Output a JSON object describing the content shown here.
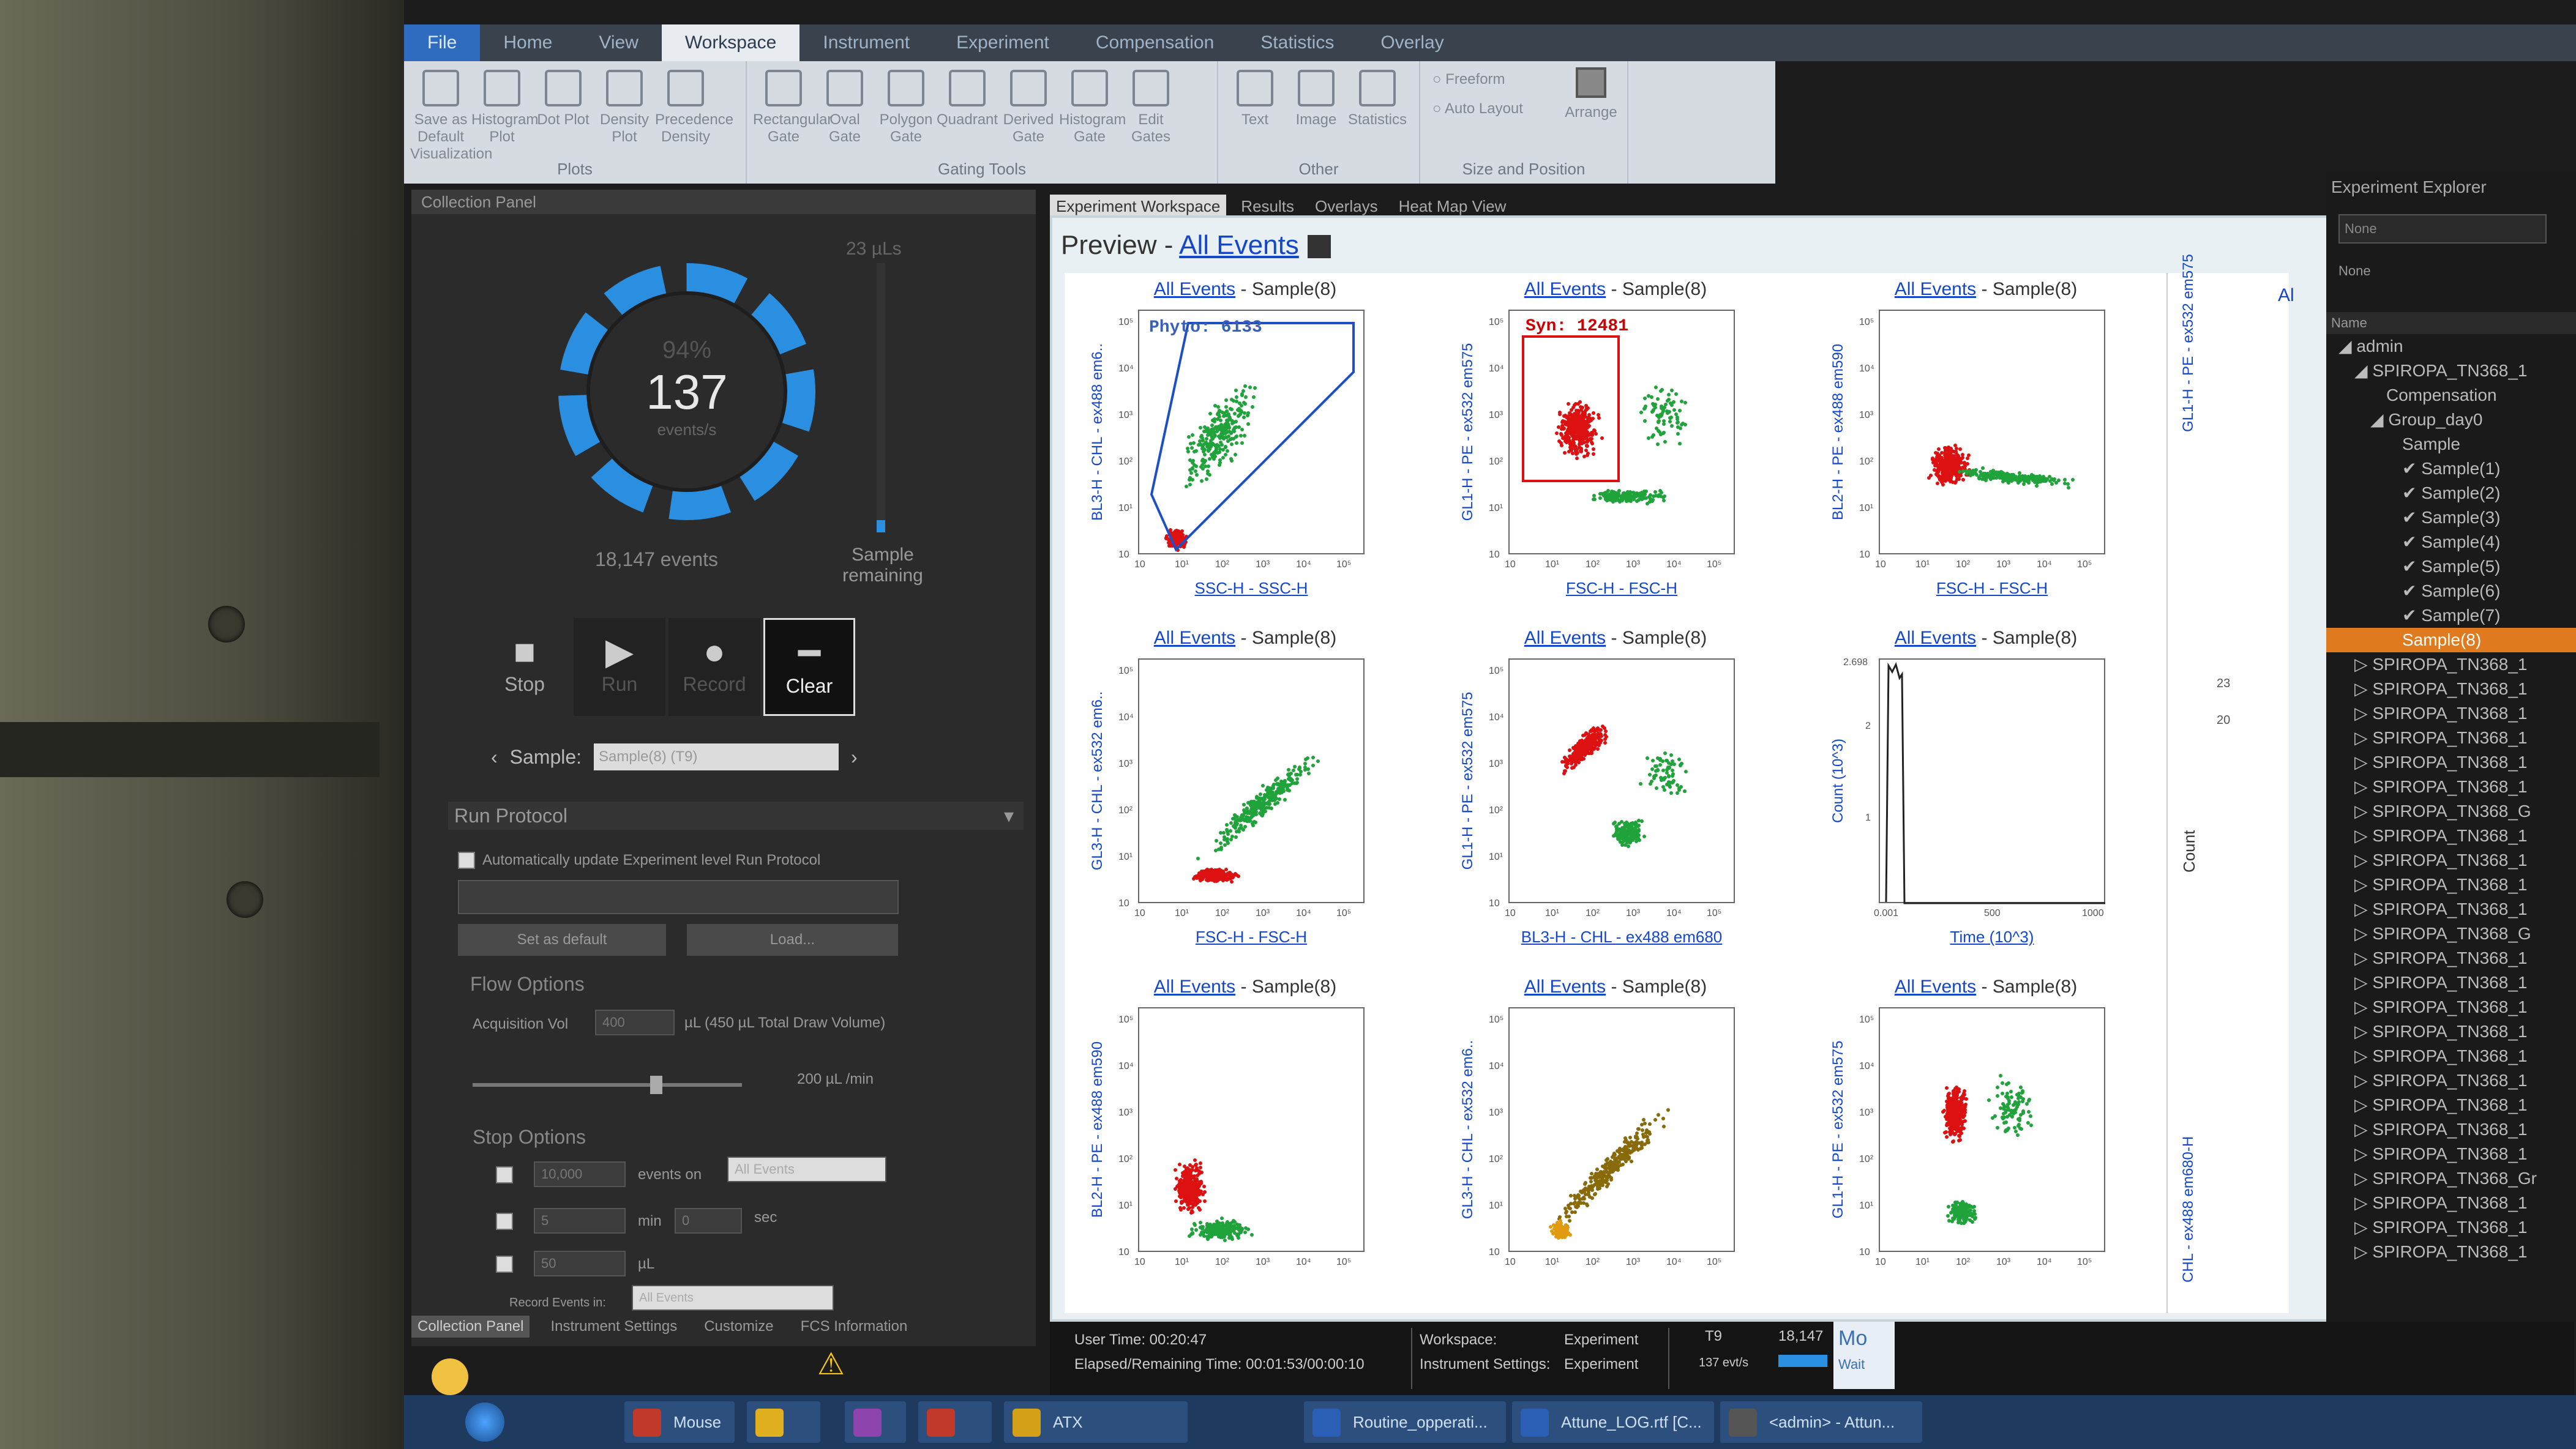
{
  "ribbon": {
    "tabs": [
      "File",
      "Home",
      "View",
      "Workspace",
      "Instrument",
      "Experiment",
      "Compensation",
      "Statistics",
      "Overlay"
    ],
    "plots": {
      "buttons": [
        "Save as Default Visualization",
        "Histogram Plot",
        "Dot Plot",
        "Density Plot",
        "Precedence Density"
      ],
      "label": "Plots"
    },
    "gating": {
      "buttons": [
        "Rectangular Gate",
        "Oval Gate",
        "Polygon Gate",
        "Quadrant",
        "Derived Gate",
        "Histogram Gate",
        "Edit Gates"
      ],
      "label": "Gating Tools"
    },
    "other": {
      "buttons": [
        "Text",
        "Image",
        "Statistics"
      ],
      "label": "Other"
    },
    "size": {
      "freeform": "Freeform",
      "auto": "Auto Layout",
      "arrange": "Arrange",
      "label": "Size and Position"
    }
  },
  "collection": {
    "title": "Collection Panel",
    "percent": "94%",
    "rate": "137",
    "rate_unit": "events/s",
    "events": "18,147 events",
    "volume": "23 µLs",
    "remaining": "Sample remaining",
    "stop": "Stop",
    "run": "Run",
    "record": "Record",
    "clear": "Clear",
    "sample_label": "Sample:",
    "sample_value": "Sample(8) (T9)",
    "run_protocol": "Run Protocol",
    "auto_update": "Automatically update Experiment level Run Protocol",
    "set_default": "Set as default",
    "load": "Load...",
    "flow_options": "Flow Options",
    "acq_vol_label": "Acquisition Vol",
    "acq_vol": "400",
    "acq_vol_unit": "µL (450 µL Total Draw Volume)",
    "flow_rate": "200 µL /min",
    "stop_options": "Stop Options",
    "stop_events": "10,000",
    "events_on": "events on",
    "events_on_value": "All Events",
    "stop_min": "5",
    "min": "min",
    "stop_sec": "0",
    "sec": "sec",
    "stop_ul": "50",
    "ul": "µL",
    "record_events": "Record Events in:",
    "record_value": "All Events",
    "bottom_tabs": [
      "Collection Panel",
      "Instrument Settings",
      "Customize",
      "FCS Information"
    ]
  },
  "workspace": {
    "tabs": [
      "Experiment Workspace",
      "Results",
      "Overlays",
      "Heat Map View"
    ],
    "preview": "Preview - ",
    "preview_link": "All Events",
    "plots": [
      {
        "ev": "All Events",
        "sample": " - Sample(8)",
        "x": "SSC-H - SSC-H",
        "y": "BL3-H - CHL - ex488 em6..",
        "gate": "Phyto: 6133",
        "ticks": [
          "10",
          "10¹",
          "10²",
          "10³",
          "10⁴",
          "10⁵"
        ]
      },
      {
        "ev": "All Events",
        "sample": " - Sample(8)",
        "x": "FSC-H - FSC-H",
        "y": "GL1-H - PE - ex532 em575",
        "gate": "Syn: 12481",
        "ticks": [
          "10",
          "10¹",
          "10²",
          "10³",
          "10⁴",
          "10⁵"
        ]
      },
      {
        "ev": "All Events",
        "sample": " - Sample(8)",
        "x": "FSC-H - FSC-H",
        "y": "BL2-H - PE - ex488 em590",
        "ticks": [
          "10",
          "10¹",
          "10²",
          "10³",
          "10⁴",
          "10⁵"
        ]
      },
      {
        "ev": "All Events",
        "sample": " - Sample(8)",
        "x": "FSC-H - FSC-H",
        "y": "GL3-H - CHL - ex532 em6..",
        "ticks": [
          "10",
          "10¹",
          "10²",
          "10³",
          "10⁴",
          "10⁵"
        ]
      },
      {
        "ev": "All Events",
        "sample": " - Sample(8)",
        "x": "BL3-H - CHL - ex488 em680",
        "y": "GL1-H - PE - ex532 em575",
        "ticks": [
          "10",
          "10¹",
          "10²",
          "10³",
          "10⁴",
          "10⁵"
        ]
      },
      {
        "ev": "All Events",
        "sample": " - Sample(8)",
        "x": "Time (10^3)",
        "y": "Count (10^3)",
        "ymax": "2.698",
        "yticks": [
          "2",
          "1"
        ],
        "xticks": [
          "0.001",
          "500",
          "1000"
        ]
      },
      {
        "ev": "All Events",
        "sample": " - Sample(8)",
        "x": "",
        "y": "BL2-H - PE - ex488 em590",
        "ticks": [
          "10",
          "10¹",
          "10²",
          "10³",
          "10⁴",
          "10⁵"
        ]
      },
      {
        "ev": "All Events",
        "sample": " - Sample(8)",
        "x": "",
        "y": "GL3-H - CHL - ex532 em6..",
        "ticks": [
          "10",
          "10¹",
          "10²",
          "10³",
          "10⁴",
          "10⁵"
        ]
      },
      {
        "ev": "All Events",
        "sample": " - Sample(8)",
        "x": "",
        "y": "GL1-H - PE - ex532 em575",
        "ticks": [
          "10",
          "10¹",
          "10²",
          "10³",
          "10⁴",
          "10⁵"
        ]
      }
    ],
    "partial": {
      "ev": "Al",
      "y1": "GL1-H - PE - ex532 em575",
      "y2": "Count",
      "y3": "CHL - ex488 em680-H",
      "t1": "23",
      "t2": "20"
    }
  },
  "explorer": {
    "title": "Experiment Explorer",
    "select": "None",
    "none": "None",
    "name_col": "Name",
    "tree": [
      {
        "t": "◢ admin",
        "indent": 0
      },
      {
        "t": "◢ SPIROPA_TN368_1",
        "indent": 1
      },
      {
        "t": "Compensation",
        "indent": 3
      },
      {
        "t": "◢ Group_day0",
        "indent": 2
      },
      {
        "t": "Sample",
        "indent": 4
      },
      {
        "t": "✔ Sample(1)",
        "indent": 4
      },
      {
        "t": "✔ Sample(2)",
        "indent": 4
      },
      {
        "t": "✔ Sample(3)",
        "indent": 4
      },
      {
        "t": "✔ Sample(4)",
        "indent": 4
      },
      {
        "t": "✔ Sample(5)",
        "indent": 4
      },
      {
        "t": "✔ Sample(6)",
        "indent": 4
      },
      {
        "t": "✔ Sample(7)",
        "indent": 4
      },
      {
        "t": "Sample(8)",
        "indent": 4,
        "sel": true
      },
      {
        "t": "▷ SPIROPA_TN368_1",
        "indent": 1
      },
      {
        "t": "▷ SPIROPA_TN368_1",
        "indent": 1
      },
      {
        "t": "▷ SPIROPA_TN368_1",
        "indent": 1
      },
      {
        "t": "▷ SPIROPA_TN368_1",
        "indent": 1
      },
      {
        "t": "▷ SPIROPA_TN368_1",
        "indent": 1
      },
      {
        "t": "▷ SPIROPA_TN368_1",
        "indent": 1
      },
      {
        "t": "▷ SPIROPA_TN368_G",
        "indent": 1
      },
      {
        "t": "▷ SPIROPA_TN368_1",
        "indent": 1
      },
      {
        "t": "▷ SPIROPA_TN368_1",
        "indent": 1
      },
      {
        "t": "▷ SPIROPA_TN368_1",
        "indent": 1
      },
      {
        "t": "▷ SPIROPA_TN368_1",
        "indent": 1
      },
      {
        "t": "▷ SPIROPA_TN368_G",
        "indent": 1
      },
      {
        "t": "▷ SPIROPA_TN368_1",
        "indent": 1
      },
      {
        "t": "▷ SPIROPA_TN368_1",
        "indent": 1
      },
      {
        "t": "▷ SPIROPA_TN368_1",
        "indent": 1
      },
      {
        "t": "▷ SPIROPA_TN368_1",
        "indent": 1
      },
      {
        "t": "▷ SPIROPA_TN368_1",
        "indent": 1
      },
      {
        "t": "▷ SPIROPA_TN368_1",
        "indent": 1
      },
      {
        "t": "▷ SPIROPA_TN368_1",
        "indent": 1
      },
      {
        "t": "▷ SPIROPA_TN368_1",
        "indent": 1
      },
      {
        "t": "▷ SPIROPA_TN368_1",
        "indent": 1
      },
      {
        "t": "▷ SPIROPA_TN368_Gr",
        "indent": 1
      },
      {
        "t": "▷ SPIROPA_TN368_1",
        "indent": 1
      },
      {
        "t": "▷ SPIROPA_TN368_1",
        "indent": 1
      },
      {
        "t": "▷ SPIROPA_TN368_1",
        "indent": 1
      }
    ]
  },
  "status": {
    "user_time": "User Time: 00:20:47",
    "elapsed": "Elapsed/Remaining Time: 00:01:53/00:00:10",
    "workspace_label": "Workspace:",
    "workspace_val": "Experiment",
    "inst_label": "Instrument Settings:",
    "inst_val": "Experiment",
    "t9": "T9",
    "evs": "137 evt/s",
    "count": "18,147",
    "mode": "Mo",
    "wait": "Wait"
  },
  "taskbar": [
    {
      "label": "Mouse Recorder ...",
      "color": "#c0392b"
    },
    {
      "label": "",
      "color": "#e0b020"
    },
    {
      "label": "",
      "color": "#8e44ad"
    },
    {
      "label": "",
      "color": "#c0392b"
    },
    {
      "label": "ATX",
      "color": "#d4a017"
    },
    {
      "label": "Routine_opperati...",
      "color": "#2b5fb5"
    },
    {
      "label": "Attune_LOG.rtf [C...",
      "color": "#2b5fb5"
    },
    {
      "label": "<admin> - Attun...",
      "color": "#555"
    }
  ]
}
